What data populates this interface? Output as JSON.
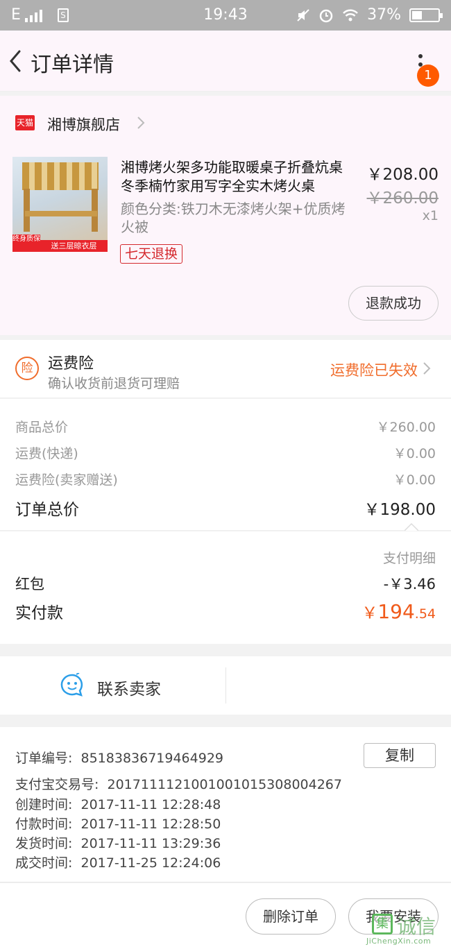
{
  "status_bar": {
    "network": "E",
    "sim": "S",
    "time": "19:43",
    "battery": "37%"
  },
  "header": {
    "title": "订单详情",
    "notification_count": "1"
  },
  "shop": {
    "logo_text": "天猫",
    "name": "湘博旗舰店"
  },
  "item": {
    "title": "湘博烤火架多功能取暖桌子折叠炕桌冬季楠竹家用写字全实木烤火桌",
    "sku": "颜色分类:铁刀木无漆烤火架+优质烤火被",
    "image_tag_left": "终身质保",
    "image_tag_right": "送三层晾衣层",
    "service_tag": "七天退换",
    "price": "￥208.00",
    "original_price": "￥260.00",
    "quantity": "x1",
    "refund_status": "退款成功"
  },
  "insurance": {
    "icon_text": "险",
    "title": "运费险",
    "subtitle": "确认收货前退货可理赔",
    "status": "运费险已失效",
    "status_color": "#f06c2b"
  },
  "price_breakdown": {
    "rows": [
      {
        "label": "商品总价",
        "value": "￥260.00"
      },
      {
        "label": "运费(快递)",
        "value": "￥0.00"
      },
      {
        "label": "运费险(卖家赠送)",
        "value": "￥0.00"
      }
    ],
    "total_label": "订单总价",
    "total_value": "￥198.00"
  },
  "payment": {
    "detail_label": "支付明细",
    "hongbao_label": "红包",
    "hongbao_value": "-￥3.46",
    "paid_label": "实付款",
    "paid_currency": "￥",
    "paid_int": "194",
    "paid_dec": ".54",
    "accent_color": "#f05a1a"
  },
  "contact": {
    "label": "联系卖家",
    "icon": "chat-bubble-icon"
  },
  "order_info": {
    "order_no_label": "订单编号:",
    "order_no": "85183836719464929",
    "copy_label": "复制",
    "alipay_label": "支付宝交易号:",
    "alipay_no": "2017111121001001015308004267",
    "created_label": "创建时间:",
    "created": "2017-11-11 12:28:48",
    "paid_label": "付款时间:",
    "paid": "2017-11-11 12:28:50",
    "shipped_label": "发货时间:",
    "shipped": "2017-11-11 13:29:36",
    "closed_label": "成交时间:",
    "closed": "2017-11-25 12:24:06"
  },
  "bottom_bar": {
    "delete_label": "删除订单",
    "install_label": "我要安装"
  },
  "watermark": {
    "mark": "集",
    "text": "诚信",
    "url": "JiChengXin.com"
  }
}
